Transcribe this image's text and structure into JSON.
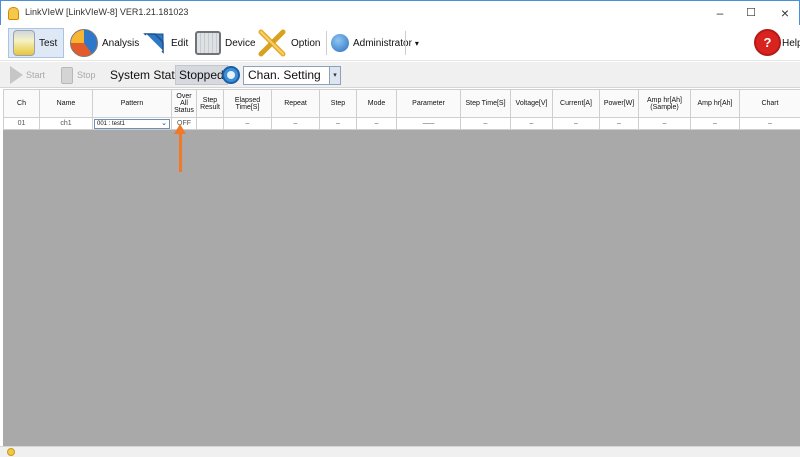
{
  "window": {
    "title": "LinkVIeW [LinkVIeW-8] VER1.21.181023",
    "controls": [
      "–",
      "☐",
      "×"
    ]
  },
  "toolbar": {
    "test_label": "Test",
    "analysis_label": "Analysis",
    "edit_label": "Edit",
    "device_label": "Device",
    "option_label": "Option",
    "admin_label": "Administrator",
    "admin_caret": "▾",
    "help_label": "Help"
  },
  "toolbar2": {
    "start_label": "Start",
    "stop_label": "Stop",
    "system_state_label": "System State:",
    "system_state_value": "Stopped",
    "channel_setting_value": "Chan. Setting",
    "channel_setting_caret": "▾"
  },
  "grid": {
    "columns": [
      "Ch",
      "Name",
      "Pattern",
      "Over All Status",
      "Step Result",
      "Elapsed Time[S]",
      "Repeat",
      "Step",
      "Mode",
      "Parameter",
      "Step Time[S]",
      "Voltage[V]",
      "Current[A]",
      "Power[W]",
      "Amp hr[Ah] (Sample)",
      "Amp hr[Ah]",
      "Chart"
    ],
    "rows": [
      {
        "ch": "01",
        "name": "ch1",
        "pattern": "001 : test1",
        "pattern_chevron": "⌄",
        "overall_status": "OFF",
        "step_result": "",
        "elapsed_time": "–",
        "repeat": "–",
        "step": "–",
        "mode": "–",
        "parameter": "–––",
        "step_time": "–",
        "voltage": "–",
        "current": "–",
        "power": "–",
        "amp_hr_sample": "–",
        "amp_hr": "–",
        "chart": "–"
      }
    ]
  },
  "colors": {
    "accent_arrow": "#f07a2a",
    "chart_cell": "#ff1515",
    "grid_background": "#a9a9a9"
  }
}
